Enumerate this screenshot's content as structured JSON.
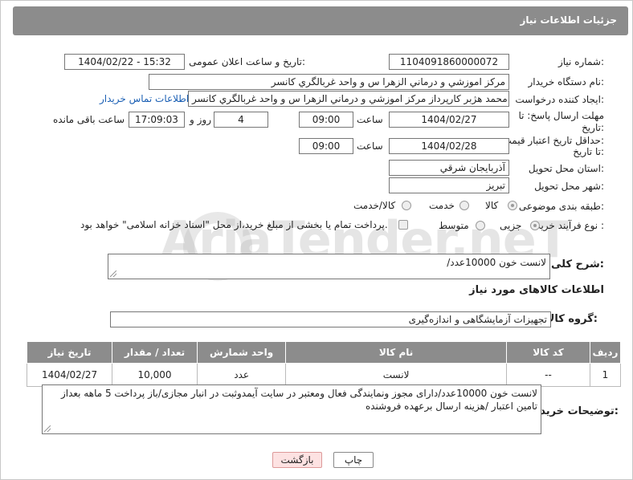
{
  "header": {
    "title": "جزئیات اطلاعات نیاز"
  },
  "fields": {
    "need_number_label": "شماره نیاز:",
    "need_number": "1104091860000072",
    "announce_label": "تاریخ و ساعت اعلان عمومی:",
    "announce_value": "1404/02/22 - 15:32",
    "buyer_org_label": "نام دستگاه خریدار:",
    "buyer_org": "مرکز اموزشي و درماني الزهرا س  و واحد غربالگري کانسر",
    "creator_label": "ایجاد کننده درخواست:",
    "creator": "محمد هژبر کارپرداز مرکز اموزشي و درماني الزهرا س  و واحد غربالگري کانسر",
    "contact_link": "اطلاعات تماس خریدار",
    "reply_deadline_label_1": "مهلت ارسال پاسخ: تا",
    "reply_deadline_label_2": "تاریخ:",
    "reply_date": "1404/02/27",
    "time_label": "ساعت",
    "reply_time": "09:00",
    "days_value": "4",
    "days_label": "روز و",
    "remaining_time": "17:09:03",
    "remaining_label": "ساعت باقی مانده",
    "price_deadline_label_1": "حداقل تاریخ اعتبار قیمت:",
    "price_deadline_label_2": "تا تاریخ:",
    "price_date": "1404/02/28",
    "price_time": "09:00",
    "province_label": "استان محل تحویل:",
    "province": "آذربايجان شرقي",
    "city_label": "شهر محل تحویل:",
    "city": "تبریز",
    "category_label": "طبقه بندی موضوعی:",
    "category_options": [
      "کالا",
      "خدمت",
      "کالا/خدمت"
    ],
    "process_label": "نوع فرآیند خرید :",
    "process_options": [
      "جزیی",
      "متوسط"
    ],
    "payment_note": "پرداخت تمام یا بخشی از مبلغ خرید،از محل \"اسناد خزانه اسلامی\" خواهد بود."
  },
  "description": {
    "label": "شرح کلی نیاز:",
    "value": "لانست خون 10000عدد/"
  },
  "goods": {
    "section_title": "اطلاعات کالاهای مورد نیاز",
    "group_label": "گروه کالا:",
    "group_value": "تجهیزات آزمایشگاهی و اندازه‌گیری",
    "columns": [
      "ردیف",
      "کد کالا",
      "نام کالا",
      "واحد شمارش",
      "تعداد / مقدار",
      "تاریخ نیاز"
    ],
    "rows": [
      [
        "1",
        "--",
        "لانست",
        "عدد",
        "10,000",
        "1404/02/27"
      ]
    ]
  },
  "buyer_notes": {
    "label": "توضیحات خریدار:",
    "value": "لانست خون 10000عدد/دارای مجوز ونمایندگی فعال ومعتبر در سایت آیمدوثبت در انبار مجازی/باز پرداخت 5 ماهه بعداز تامین اعتبار /هزینه ارسال برعهده فروشنده"
  },
  "buttons": {
    "print": "چاپ",
    "back": "بازگشت"
  },
  "watermark": "AriaTender.neT",
  "colors": {
    "header_bg": "#8c8c8c",
    "link": "#1a5fb4",
    "back_button_bg": "#fde2e2"
  }
}
